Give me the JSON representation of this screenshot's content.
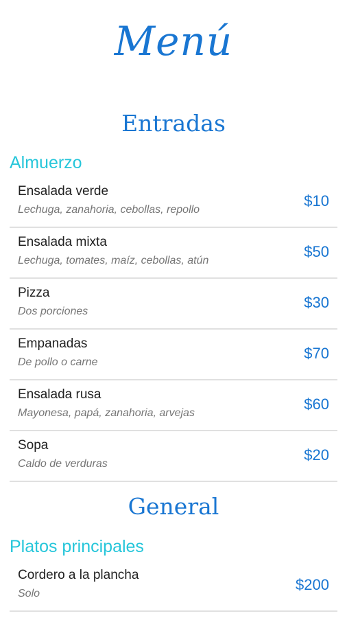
{
  "header": {
    "title": "Menú"
  },
  "sections": [
    {
      "title": "Entradas",
      "category": "Almuerzo",
      "items": [
        {
          "name": "Ensalada verde",
          "description": "Lechuga, zanahoria, cebollas, repollo",
          "price": "$10"
        },
        {
          "name": "Ensalada mixta",
          "description": "Lechuga, tomates, maíz, cebollas, atún",
          "price": "$50"
        },
        {
          "name": "Pizza",
          "description": "Dos porciones",
          "price": "$30"
        },
        {
          "name": "Empanadas",
          "description": "De pollo o carne",
          "price": "$70"
        },
        {
          "name": "Ensalada rusa",
          "description": "Mayonesa, papá, zanahoria, arvejas",
          "price": "$60"
        },
        {
          "name": "Sopa",
          "description": "Caldo de verduras",
          "price": "$20"
        }
      ]
    },
    {
      "title": "General",
      "category": "Platos principales",
      "items": [
        {
          "name": "Cordero a la plancha",
          "description": "Solo",
          "price": "$200"
        }
      ]
    }
  ],
  "colors": {
    "title": "#1976d2",
    "category": "#26c6da",
    "price": "#1976d2",
    "divider": "#e0e0e0"
  }
}
